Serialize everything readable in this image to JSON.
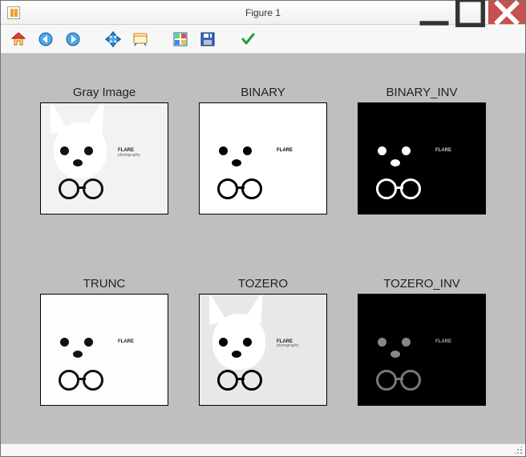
{
  "window": {
    "title": "Figure 1"
  },
  "toolbar": {
    "home": "home-icon",
    "back": "back-icon",
    "forward": "forward-icon",
    "pan": "pan-icon",
    "zoom": "zoom-icon",
    "subplots": "subplots-icon",
    "save": "save-icon",
    "options": "options-icon"
  },
  "plots": [
    {
      "title": "Gray Image",
      "style": "gray"
    },
    {
      "title": "BINARY",
      "style": "binary"
    },
    {
      "title": "BINARY_INV",
      "style": "binary_inv"
    },
    {
      "title": "TRUNC",
      "style": "trunc"
    },
    {
      "title": "TOZERO",
      "style": "tozero"
    },
    {
      "title": "TOZERO_INV",
      "style": "tozero_inv"
    }
  ],
  "caption": {
    "heading": "FLARE",
    "sub": "photography"
  },
  "colors": {
    "canvas_bg": "#bfbfbf",
    "white": "#ffffff",
    "black": "#000000",
    "light": "#f2f2f2",
    "mid": "#e8e8e8"
  }
}
